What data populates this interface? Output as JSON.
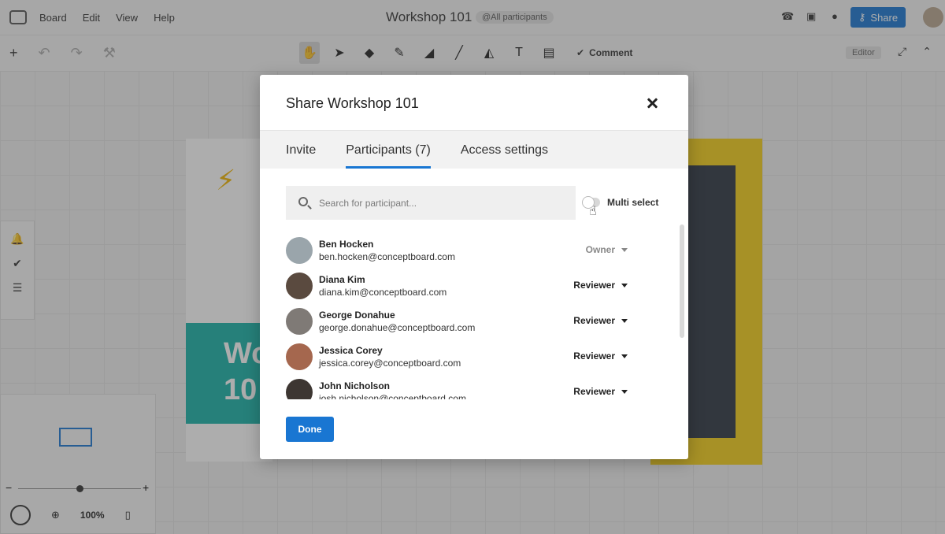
{
  "app": {
    "menu": [
      "Board",
      "Edit",
      "View",
      "Help"
    ],
    "board_title": "Workshop 101",
    "participants_badge": "@All participants",
    "share_label": "Share"
  },
  "toolbar": {
    "comment_label": "Comment",
    "editor_badge": "Editor"
  },
  "canvas": {
    "teal_card_text_1": "Wo",
    "teal_card_text_2": "10"
  },
  "minimap": {
    "zoom_level": "100%"
  },
  "modal": {
    "title": "Share Workshop 101",
    "tabs": [
      {
        "label": "Invite",
        "active": false
      },
      {
        "label": "Participants (7)",
        "active": true
      },
      {
        "label": "Access settings",
        "active": false
      }
    ],
    "search_placeholder": "Search for participant...",
    "multi_select_label": "Multi select",
    "participants": [
      {
        "name": "Ben Hocken",
        "email": "ben.hocken@conceptboard.com",
        "role": "Owner",
        "avatar_color": "#9aa5ab"
      },
      {
        "name": "Diana Kim",
        "email": "diana.kim@conceptboard.com",
        "role": "Reviewer",
        "avatar_color": "#5a4a3f"
      },
      {
        "name": "George Donahue",
        "email": "george.donahue@conceptboard.com",
        "role": "Reviewer",
        "avatar_color": "#7f7a76"
      },
      {
        "name": "Jessica Corey",
        "email": "jessica.corey@conceptboard.com",
        "role": "Reviewer",
        "avatar_color": "#a5674e"
      },
      {
        "name": "John Nicholson",
        "email": "josh.nicholson@conceptboard.com",
        "role": "Reviewer",
        "avatar_color": "#3d3632"
      }
    ],
    "done_label": "Done"
  },
  "colors": {
    "accent": "#1976d2",
    "teal": "#17b2a8",
    "yellow": "#f4cf17"
  }
}
